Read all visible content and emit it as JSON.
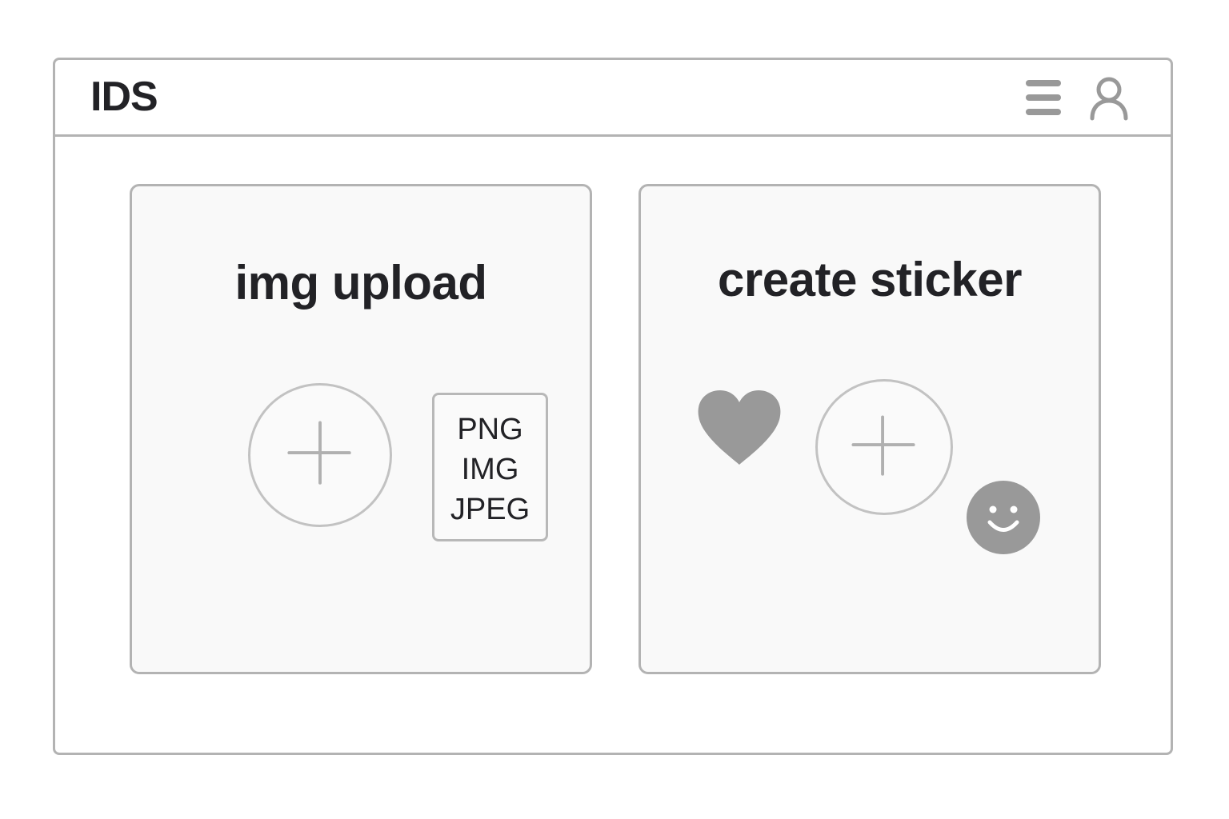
{
  "header": {
    "brand": "IDS",
    "menu_icon": "hamburger-menu-icon",
    "user_icon": "user-icon"
  },
  "cards": {
    "upload": {
      "title": "img upload",
      "add_icon": "plus-icon",
      "formats": [
        "PNG",
        "IMG",
        "JPEG"
      ]
    },
    "sticker": {
      "title": "create sticker",
      "add_icon": "plus-icon",
      "stickers": [
        "heart-icon",
        "smile-icon"
      ]
    }
  },
  "colors": {
    "border": "#b3b3b3",
    "icon_fill": "#999999",
    "text": "#222226",
    "card_bg": "#f9f9f9"
  }
}
